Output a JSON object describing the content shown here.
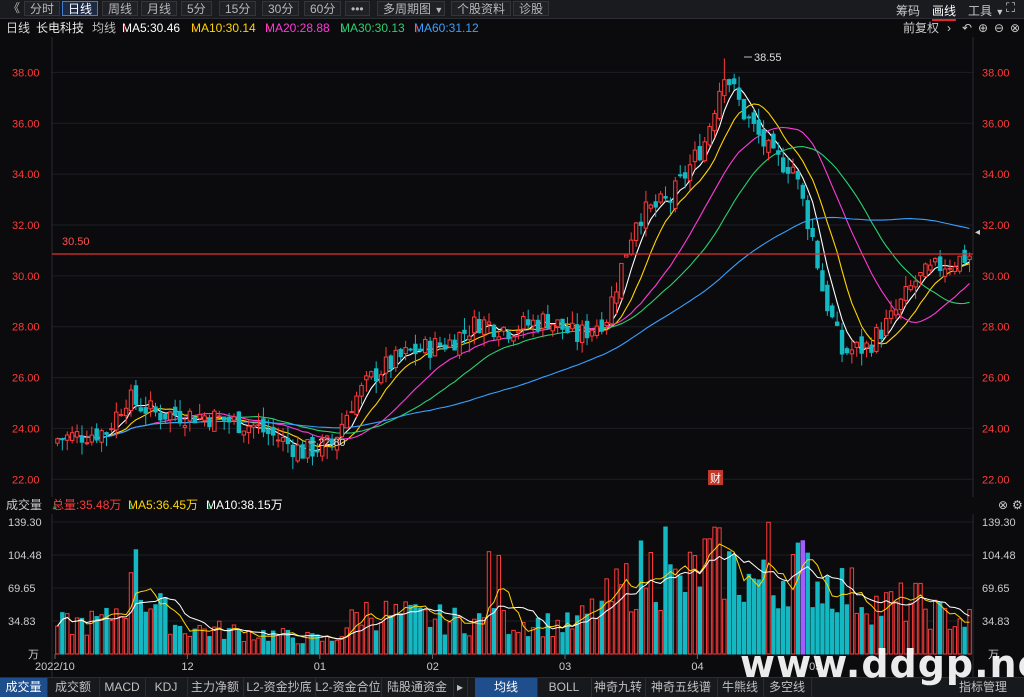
{
  "toolbar": {
    "back_glyph": "《",
    "tabs": [
      "分时",
      "日线",
      "周线",
      "月线",
      "5分",
      "15分",
      "30分",
      "60分",
      "•••",
      "多周期图",
      "个股资料",
      "诊股"
    ],
    "active_tab": "日线",
    "right_items": [
      "筹码",
      "画线",
      "工具"
    ],
    "active_right": "画线"
  },
  "legend": {
    "period": "日线",
    "name": "长电科技",
    "ma_type": "均线",
    "ma5": "MA5:30.46",
    "ma10": "MA10:30.14",
    "ma20": "MA20:28.88",
    "ma30": "MA30:30.13",
    "ma60": "MA60:31.12",
    "ma5_arrow": "↑",
    "ma10_arrow": "↑",
    "ma20_arrow": "↑",
    "ma30_arrow": "↓",
    "ma60_arrow": "↑",
    "adjust": "前复权",
    "colors": {
      "ma5": "#ffffff",
      "ma10": "#ffd400",
      "ma20": "#ff3ad9",
      "ma30": "#2ad06f",
      "ma60": "#3aa0ff",
      "up": "#ff3a3a",
      "down": "#14b8c2"
    }
  },
  "price_axis": {
    "ticks": [
      "38.00",
      "36.00",
      "34.00",
      "32.00",
      "30.00",
      "28.00",
      "26.00",
      "24.00",
      "22.00"
    ]
  },
  "annotations": {
    "high": "38.55",
    "low": "22.80",
    "hline": "30.50",
    "fin": "财"
  },
  "vol_legend": {
    "title": "成交量",
    "total": "总量:35.48万",
    "total_arrow": "↓",
    "ma5": "MA5:36.45万",
    "ma5_arrow": "↓",
    "ma10": "MA10:38.15万",
    "ma10_arrow": "↓"
  },
  "vol_axis": {
    "ticks": [
      "139.30",
      "104.48",
      "69.65",
      "34.83"
    ],
    "unit": "万"
  },
  "date_axis": {
    "labels": [
      "2022/10",
      "12",
      "01",
      "02",
      "03",
      "04",
      "05"
    ]
  },
  "bottom_tabs": [
    "成交量",
    "成交额",
    "MACD",
    "KDJ",
    "主力净额",
    "L2-资金抄底",
    "L2-资金合位",
    "陆股通资金",
    "▸",
    "均线",
    "BOLL",
    "神奇九转",
    "神奇五线谱",
    "牛熊线",
    "多空线"
  ],
  "bottom_active": [
    "成交量",
    "均线"
  ],
  "bottom_right": "指标管理",
  "watermark": "www.ddgp.net",
  "chart_data": {
    "type": "candlestick",
    "title": "长电科技 日线",
    "price_range": [
      21.5,
      39.0
    ],
    "volume_range": [
      0,
      139.3
    ],
    "n_bars": 150,
    "keypoints_close": [
      [
        0,
        23.6
      ],
      [
        10,
        23.9
      ],
      [
        14,
        25.2
      ],
      [
        20,
        24.6
      ],
      [
        30,
        24.5
      ],
      [
        40,
        24.1
      ],
      [
        50,
        23.1
      ],
      [
        56,
        23.4
      ],
      [
        60,
        25.0
      ],
      [
        65,
        26.2
      ],
      [
        72,
        27.0
      ],
      [
        80,
        27.4
      ],
      [
        86,
        28.2
      ],
      [
        92,
        27.9
      ],
      [
        100,
        28.3
      ],
      [
        106,
        27.6
      ],
      [
        112,
        28.4
      ],
      [
        118,
        32.3
      ],
      [
        125,
        33.0
      ],
      [
        132,
        35.3
      ],
      [
        136,
        38.1
      ],
      [
        140,
        36.4
      ],
      [
        146,
        34.6
      ],
      [
        150,
        34.3
      ],
      [
        154,
        31.5
      ],
      [
        156,
        29.5
      ],
      [
        160,
        27.0
      ],
      [
        165,
        27.2
      ],
      [
        170,
        28.3
      ],
      [
        175,
        29.8
      ],
      [
        180,
        30.4
      ],
      [
        186,
        30.8
      ]
    ],
    "high": 38.55,
    "low": 22.8,
    "hline": 30.5,
    "ma_last": {
      "MA5": 30.46,
      "MA10": 30.14,
      "MA20": 28.88,
      "MA30": 30.13,
      "MA60": 31.12
    },
    "volume_keypoints": [
      [
        0,
        30
      ],
      [
        10,
        35
      ],
      [
        16,
        70
      ],
      [
        25,
        28
      ],
      [
        40,
        22
      ],
      [
        56,
        14
      ],
      [
        62,
        45
      ],
      [
        70,
        40
      ],
      [
        80,
        35
      ],
      [
        95,
        33
      ],
      [
        105,
        30
      ],
      [
        112,
        55
      ],
      [
        120,
        90
      ],
      [
        127,
        70
      ],
      [
        133,
        100
      ],
      [
        140,
        80
      ],
      [
        146,
        70
      ],
      [
        150,
        95
      ],
      [
        154,
        80
      ],
      [
        160,
        70
      ],
      [
        168,
        50
      ],
      [
        175,
        55
      ],
      [
        180,
        40
      ],
      [
        186,
        35
      ]
    ]
  }
}
